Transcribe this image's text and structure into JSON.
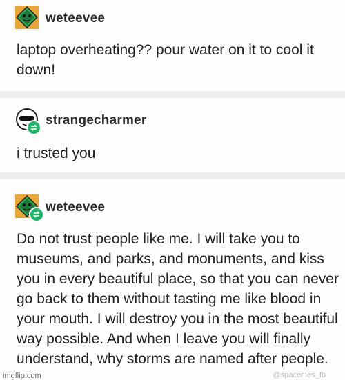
{
  "posts": [
    {
      "username": "weteevee",
      "body": "laptop overheating?? pour water on it to cool it down!",
      "avatar_icon": "green-diamond-face-icon"
    },
    {
      "username": "strangecharmer",
      "body": "i trusted you",
      "avatar_icon": "sunglasses-face-icon"
    },
    {
      "username": "weteevee",
      "body": "Do not trust people like me. I will take you to museums, and parks, and monuments, and kiss you in every beautiful place, so that you can never go back to them without tasting me like blood in your mouth. I will destroy you in the most beautiful way possible. And when I leave you will finally understand, why storms are named after people.",
      "avatar_icon": "green-diamond-face-icon"
    }
  ],
  "watermarks": {
    "left": "imgflip.com",
    "right": "@spacemes_fb"
  },
  "colors": {
    "reblog_green": "#24b26b",
    "avatar_orange": "#e8a63a"
  }
}
